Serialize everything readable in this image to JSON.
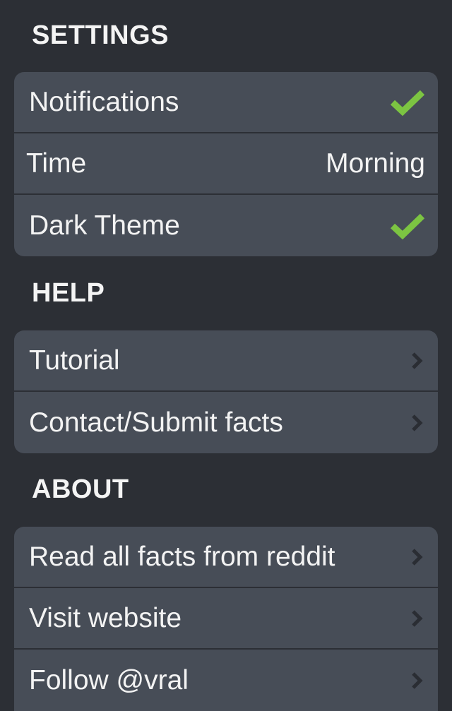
{
  "settings": {
    "title": "SETTINGS",
    "items": [
      {
        "label": "Notifications",
        "control": "check-icon",
        "checked": true
      },
      {
        "label": "Time",
        "value": "Morning"
      },
      {
        "label": "Dark Theme",
        "control": "check-icon",
        "checked": true
      }
    ]
  },
  "help": {
    "title": "HELP",
    "items": [
      {
        "label": "Tutorial",
        "control": "chevron-right-icon"
      },
      {
        "label": "Contact/Submit facts",
        "control": "chevron-right-icon"
      }
    ]
  },
  "about": {
    "title": "ABOUT",
    "items": [
      {
        "label": "Read all facts from reddit",
        "control": "chevron-right-icon"
      },
      {
        "label": "Visit website",
        "control": "chevron-right-icon"
      },
      {
        "label": "Follow @vral",
        "control": "chevron-right-icon"
      }
    ]
  },
  "colors": {
    "background": "#2c2f35",
    "cell": "#474d57",
    "check": "#7cc442",
    "chevron": "#2a2d33",
    "text": "#f3f3f3"
  }
}
